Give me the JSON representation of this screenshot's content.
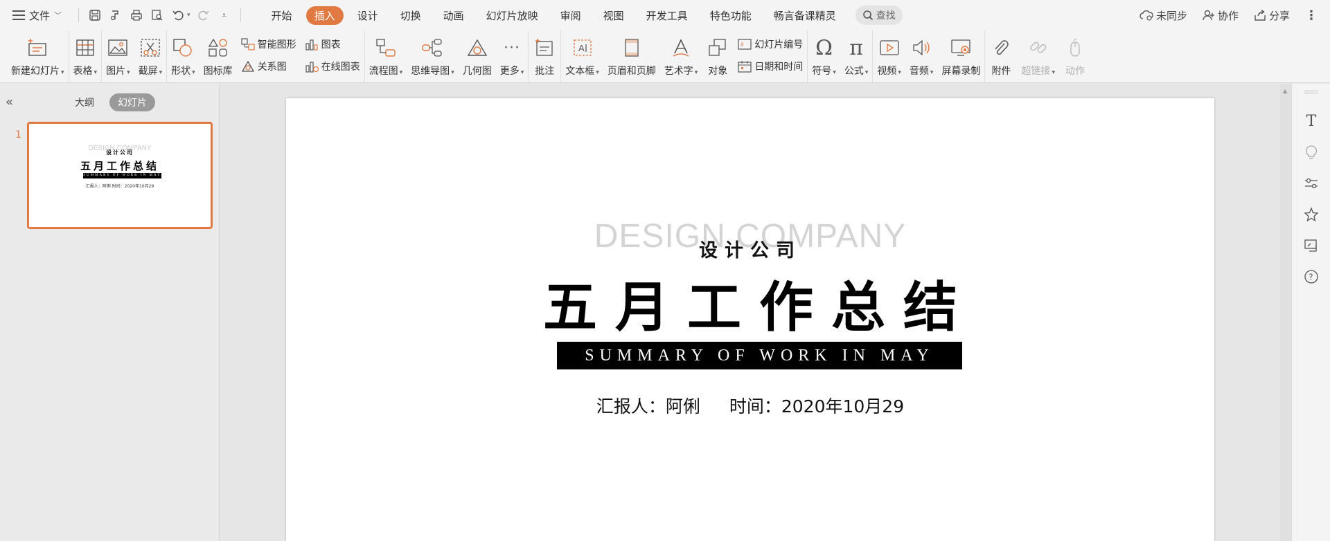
{
  "menubar": {
    "file_label": "文件",
    "tabs": [
      {
        "label": "开始",
        "active": false
      },
      {
        "label": "插入",
        "active": true
      },
      {
        "label": "设计",
        "active": false
      },
      {
        "label": "切换",
        "active": false
      },
      {
        "label": "动画",
        "active": false
      },
      {
        "label": "幻灯片放映",
        "active": false
      },
      {
        "label": "审阅",
        "active": false
      },
      {
        "label": "视图",
        "active": false
      },
      {
        "label": "开发工具",
        "active": false
      },
      {
        "label": "特色功能",
        "active": false
      },
      {
        "label": "畅言备课精灵",
        "active": false
      }
    ],
    "search_label": "查找",
    "unsync_label": "未同步",
    "collab_label": "协作",
    "share_label": "分享"
  },
  "ribbon": {
    "new_slide": "新建幻灯片",
    "table": "表格",
    "picture": "图片",
    "screenshot": "截屏",
    "shape": "形状",
    "icon_library": "图标库",
    "smart_art": "智能图形",
    "chart": "图表",
    "relation": "关系图",
    "online_chart": "在线图表",
    "flowchart": "流程图",
    "mindmap": "思维导图",
    "geometry": "几何图",
    "more": "更多",
    "comment": "批注",
    "textbox": "文本框",
    "header_footer": "页眉和页脚",
    "wordart": "艺术字",
    "object": "对象",
    "slide_number": "幻灯片编号",
    "datetime": "日期和时间",
    "symbol": "符号",
    "formula": "公式",
    "video": "视频",
    "audio": "音频",
    "screen_record": "屏幕录制",
    "attachment": "附件",
    "hyperlink": "超链接",
    "action": "动作"
  },
  "leftpanel": {
    "outline_tab": "大纲",
    "slides_tab": "幻灯片",
    "slide_number": "1"
  },
  "slide": {
    "english_watermark": "DESIGN COMPANY",
    "company": "设计公司",
    "title": "五月工作总结",
    "subtitle": "SUMMARY OF WORK IN MAY",
    "reporter": "汇报人：阿俐",
    "time": "时间：2020年10月29"
  },
  "thumbnail": {
    "info": "汇报人：阿俐     时间：2020年10月29"
  },
  "colors": {
    "accent": "#e07a42",
    "slide_bar": "#000000",
    "watermark": "#d4d4d4"
  }
}
